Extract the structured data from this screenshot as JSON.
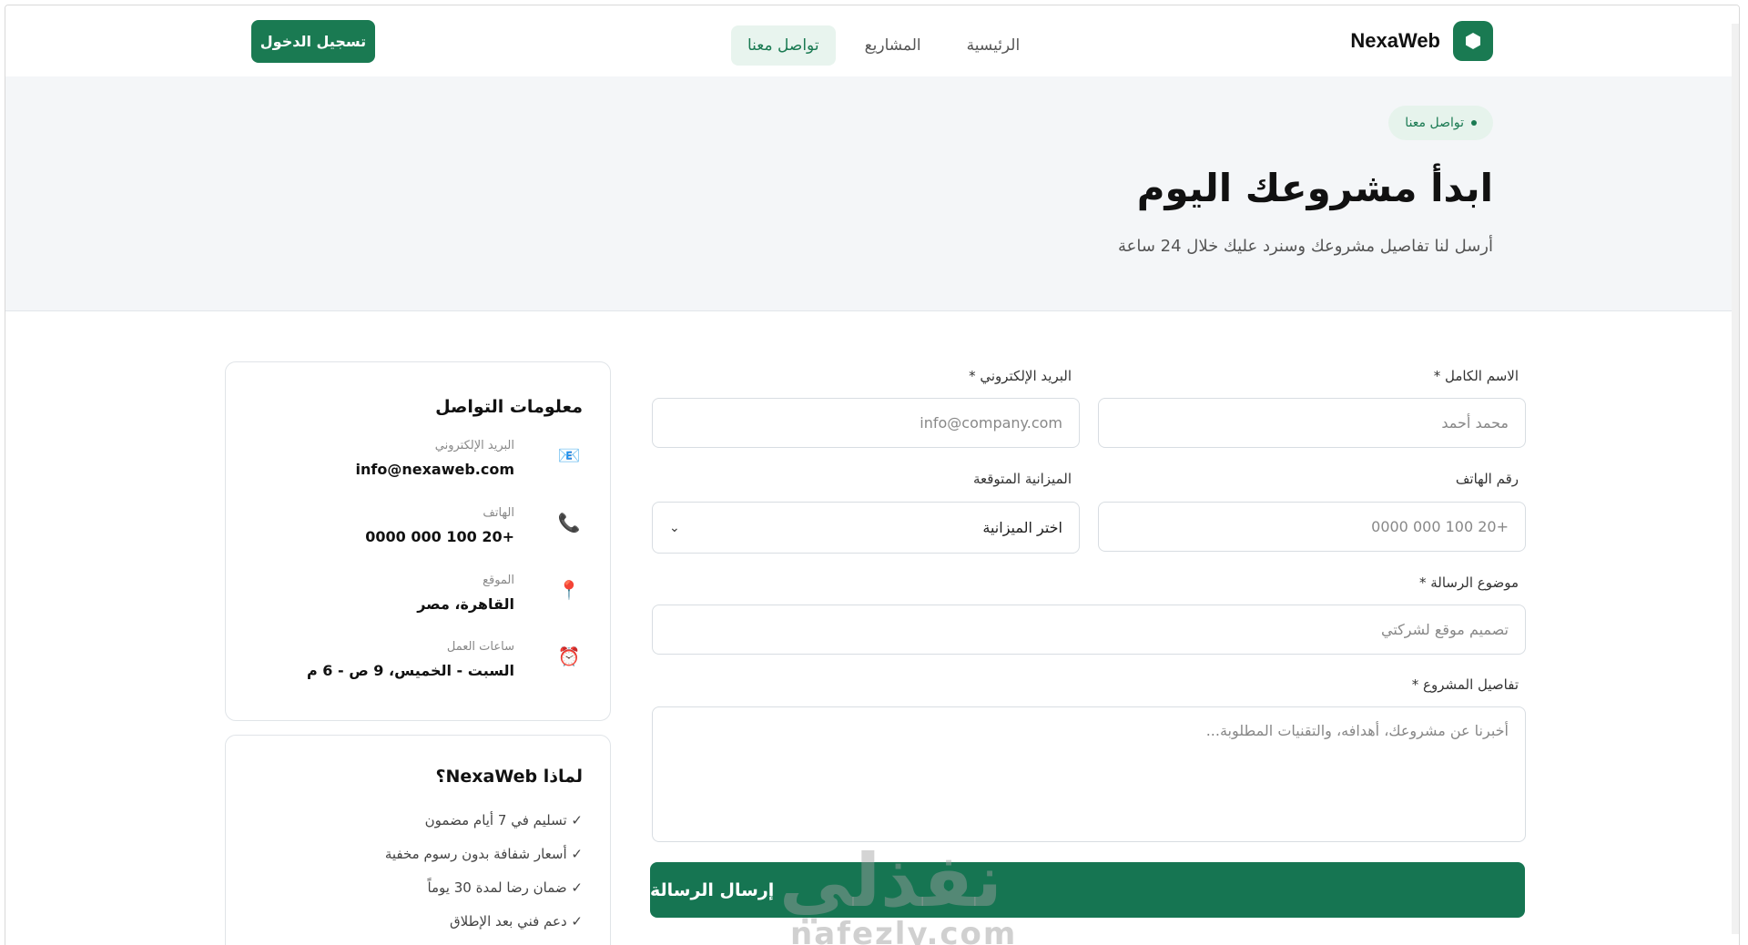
{
  "header": {
    "brand": "NexaWeb",
    "nav": [
      "الرئيسية",
      "المشاريع",
      "تواصل معنا"
    ],
    "active_nav": "تواصل معنا",
    "login": "تسجيل الدخول"
  },
  "hero": {
    "tag": "تواصل معنا",
    "title": "ابدأ مشروعك اليوم",
    "subtitle": "أرسل لنا تفاصيل مشروعك وسنرد عليك خلال 24 ساعة"
  },
  "form": {
    "name_label": "الاسم الكامل *",
    "name_placeholder": "محمد أحمد",
    "email_label": "البريد الإلكتروني *",
    "email_placeholder": "info@company.com",
    "phone_label": "رقم الهاتف",
    "phone_placeholder": "+20 100 000 0000",
    "budget_label": "الميزانية المتوقعة",
    "budget_value": "اختر الميزانية",
    "subject_label": "موضوع الرسالة *",
    "subject_placeholder": "تصميم موقع لشركتي",
    "details_label": "تفاصيل المشروع *",
    "details_placeholder": "أخبرنا عن مشروعك، أهدافه، والتقنيات المطلوبة...",
    "submit": "إرسال الرسالة"
  },
  "contact_card": {
    "title": "معلومات التواصل",
    "items": [
      {
        "label": "البريد الإلكتروني",
        "value": "info@nexaweb.com",
        "icon": "email-icon"
      },
      {
        "label": "الهاتف",
        "value": "+20 100 000 0000",
        "icon": "phone-icon"
      },
      {
        "label": "الموقع",
        "value": "القاهرة، مصر",
        "icon": "location-pin-icon"
      },
      {
        "label": "ساعات العمل",
        "value": "السبت - الخميس، 9 ص - 6 م",
        "icon": "alarm-clock-icon"
      }
    ]
  },
  "why_card": {
    "title": "لماذا NexaWeb؟",
    "items": [
      "✓ تسليم في 7 أيام مضمون",
      "✓ أسعار شفافة بدون رسوم مخفية",
      "✓ ضمان رضا لمدة 30 يوماً",
      "✓ دعم فني بعد الإطلاق"
    ]
  },
  "watermark": {
    "arabic": "نفذلي",
    "latin": "nafezly.com"
  },
  "colors": {
    "primary": "#1a7a52",
    "hero_bg": "#f4f6f8"
  }
}
